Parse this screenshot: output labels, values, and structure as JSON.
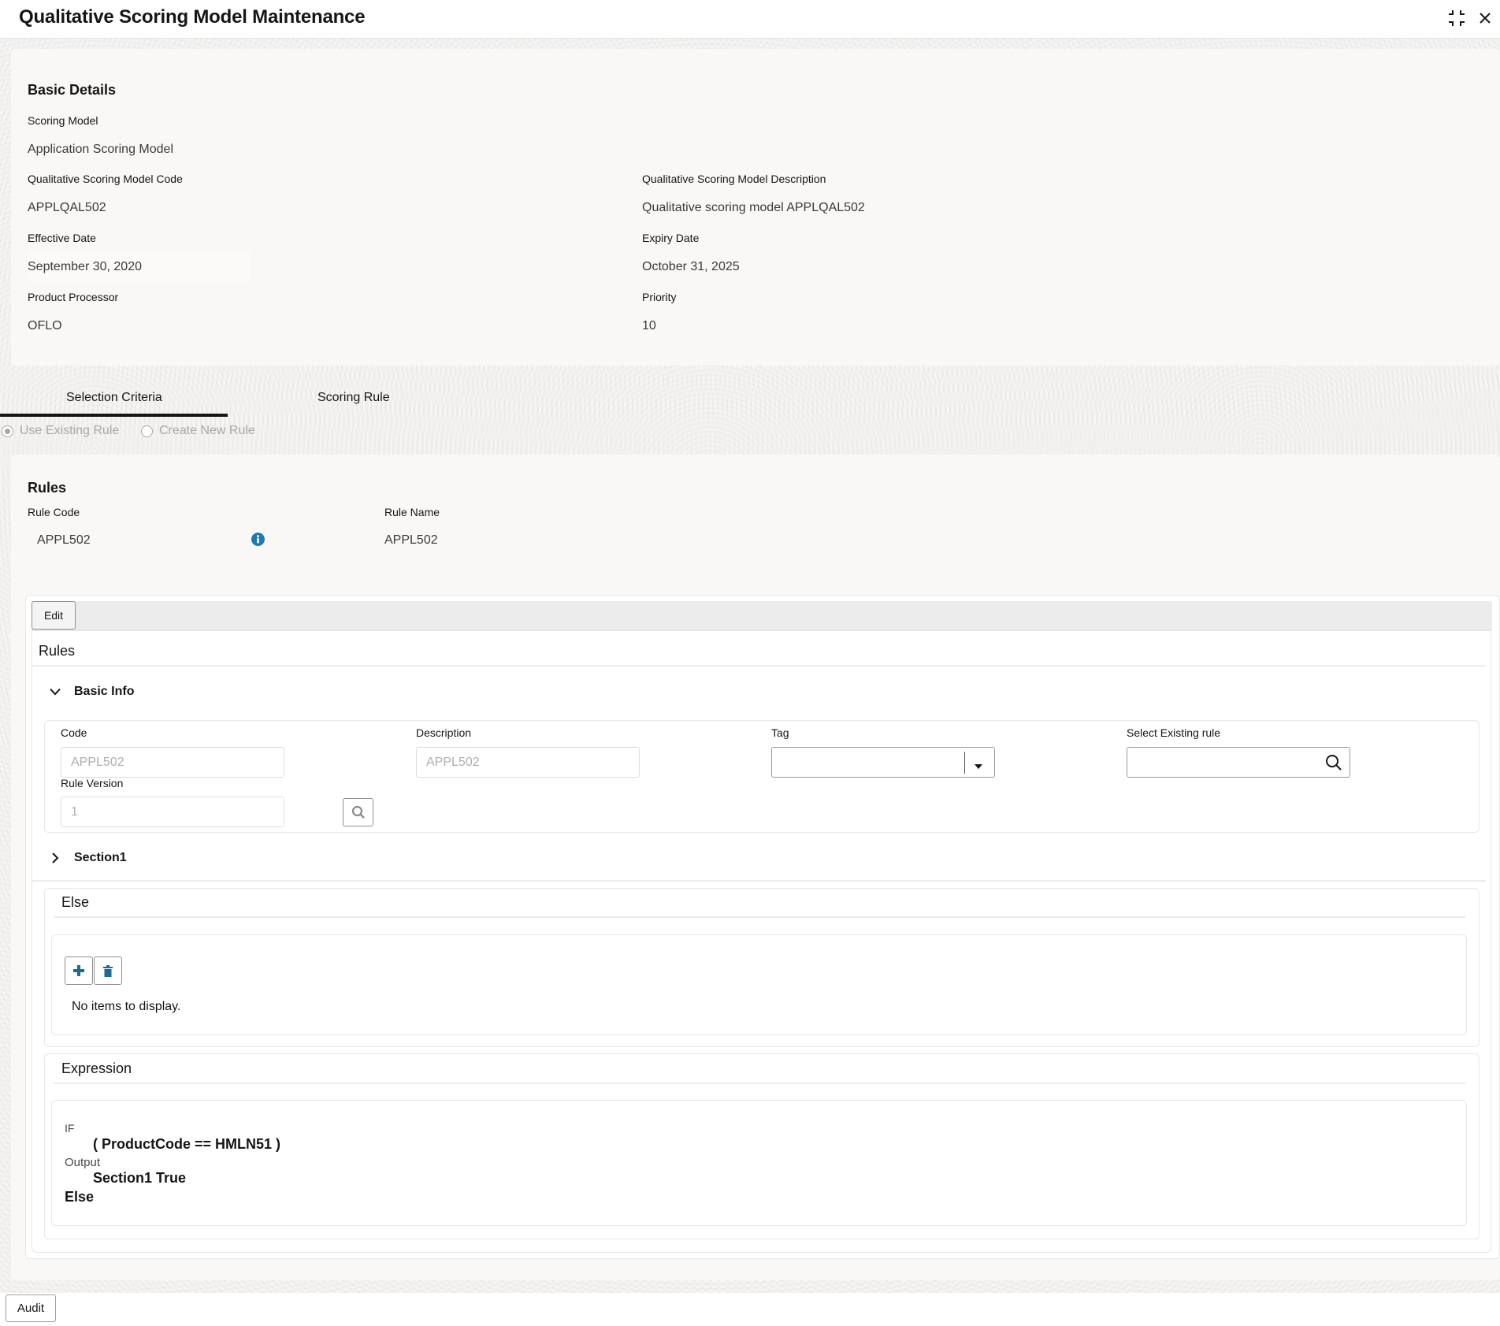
{
  "window": {
    "title": "Qualitative Scoring Model Maintenance",
    "minimize_icon": "collapse-arrows-icon",
    "close_icon": "close-icon"
  },
  "basic_details": {
    "heading": "Basic Details",
    "scoring_model": {
      "label": "Scoring Model",
      "value": "Application Scoring Model"
    },
    "code": {
      "label": "Qualitative Scoring Model Code",
      "value": "APPLQAL502"
    },
    "description": {
      "label": "Qualitative Scoring Model Description",
      "value": "Qualitative scoring model APPLQAL502"
    },
    "effective_date": {
      "label": "Effective Date",
      "value": "September 30, 2020"
    },
    "expiry_date": {
      "label": "Expiry Date",
      "value": "October 31, 2025"
    },
    "product_processor": {
      "label": "Product Processor",
      "value": "OFLO"
    },
    "priority": {
      "label": "Priority",
      "value": "10"
    }
  },
  "tabs": [
    {
      "label": "Selection Criteria",
      "active": true
    },
    {
      "label": "Scoring Rule",
      "active": false
    }
  ],
  "rule_mode": {
    "options": [
      {
        "label": "Use Existing Rule",
        "selected": true
      },
      {
        "label": "Create New Rule",
        "selected": false
      }
    ]
  },
  "rules": {
    "heading": "Rules",
    "rule_code": {
      "label": "Rule Code",
      "value": "APPL502"
    },
    "rule_name": {
      "label": "Rule Name",
      "value": "APPL502"
    },
    "info_icon": "info-icon",
    "info_color": "#1b7ab5"
  },
  "rule_editor": {
    "edit_label": "Edit",
    "heading": "Rules",
    "basic_info": {
      "title": "Basic Info",
      "expanded": true,
      "code": {
        "label": "Code",
        "value": "APPL502"
      },
      "description": {
        "label": "Description",
        "value": "APPL502"
      },
      "tag": {
        "label": "Tag",
        "value": ""
      },
      "select_existing": {
        "label": "Select Existing rule",
        "value": ""
      },
      "rule_version": {
        "label": "Rule Version",
        "value": "1"
      }
    },
    "section1": {
      "title": "Section1",
      "expanded": false
    },
    "else_block": {
      "title": "Else",
      "add_icon": "plus-icon",
      "delete_icon": "trash-icon",
      "empty_text": "No items to display.",
      "icon_color": "#1d6a93"
    },
    "expression": {
      "title": "Expression",
      "if_label": "IF",
      "condition": "( ProductCode == HMLN51 )",
      "output_label": "Output",
      "output_value": "Section1 True",
      "else_label": "Else"
    }
  },
  "footer": {
    "audit_label": "Audit"
  }
}
